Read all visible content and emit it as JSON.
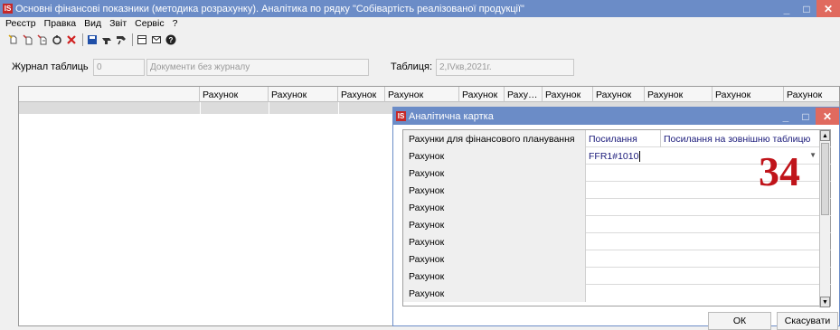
{
  "window": {
    "logo": "IS",
    "title": "Основні фінансові показники (методика розрахунку). Аналітика по рядку \"Собівартість реалізованої продукції\"",
    "minimize": "_",
    "maximize": "□",
    "close": "✕"
  },
  "menu": [
    "Реєстр",
    "Правка",
    "Вид",
    "Звіт",
    "Сервіс",
    "?"
  ],
  "toolbar": {
    "icons": [
      "new-icon",
      "copy-icon",
      "copy2-icon",
      "refresh-icon",
      "delete-icon",
      "save-icon",
      "stamp-icon",
      "brush-icon",
      "table-icon",
      "mail-icon",
      "help-icon"
    ]
  },
  "form": {
    "journal_label": "Журнал таблиць",
    "journal_number": "0",
    "journal_name": "Документи без журналу",
    "table_label": "Таблиця:",
    "table_value": "2,ІVкв,2021г."
  },
  "grid": {
    "columns": [
      "",
      "Рахунок",
      "Рахунок",
      "Рахунок",
      "Рахунок",
      "Рахунок",
      "Раху…",
      "Рахунок",
      "Рахунок",
      "Рахунок",
      "Рахунок",
      "Рахунок"
    ]
  },
  "dialog": {
    "logo": "IS",
    "title": "Аналітична картка",
    "minimize": "_",
    "maximize": "□",
    "close": "✕",
    "header": {
      "col1": "Рахунки для фінансового планування",
      "col2": "Посилання",
      "col3": "Посилання на зовнішню таблицю"
    },
    "rows": [
      {
        "label": "Рахунок",
        "value": "FFR1#1010"
      },
      {
        "label": "Рахунок",
        "value": ""
      },
      {
        "label": "Рахунок",
        "value": ""
      },
      {
        "label": "Рахунок",
        "value": ""
      },
      {
        "label": "Рахунок",
        "value": ""
      },
      {
        "label": "Рахунок",
        "value": ""
      },
      {
        "label": "Рахунок",
        "value": ""
      },
      {
        "label": "Рахунок",
        "value": ""
      },
      {
        "label": "Рахунок",
        "value": ""
      }
    ],
    "ok_label": "ОК",
    "cancel_label": "Скасувати"
  },
  "annotation": "34",
  "colors": {
    "titlebar": "#6b8cc7",
    "close_button": "#e06a5f",
    "annotation": "#c0141a"
  }
}
